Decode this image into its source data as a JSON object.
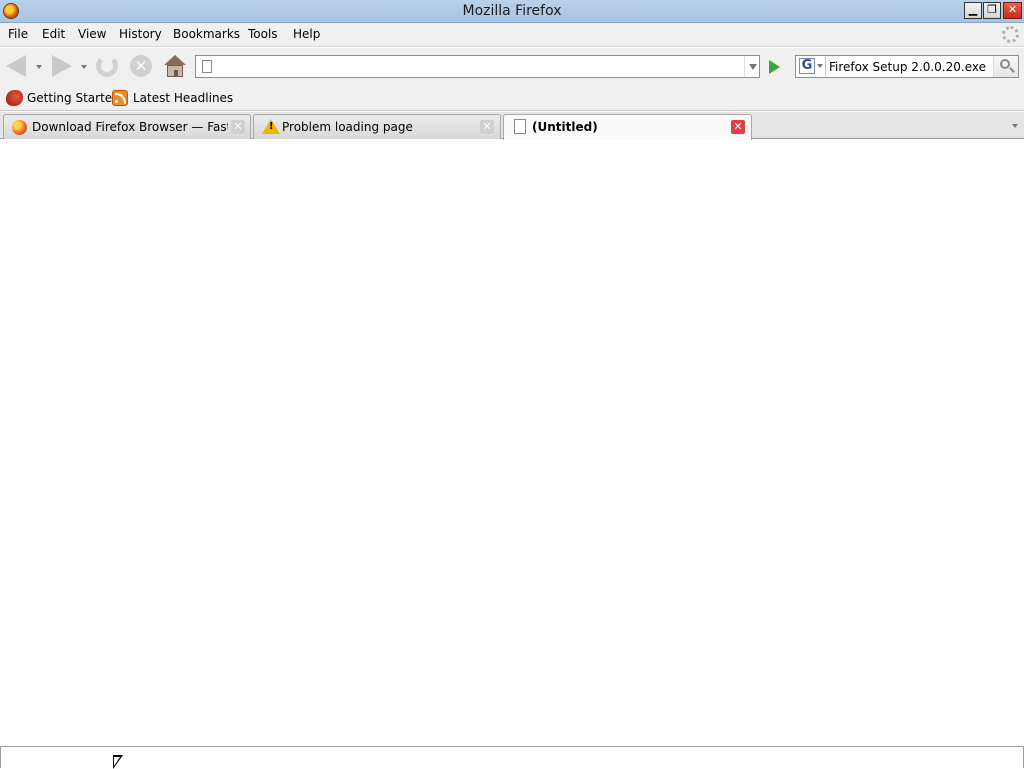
{
  "window": {
    "title": "Mozilla Firefox",
    "minimize_symbol": "▁",
    "maximize_symbol": "❐",
    "close_symbol": "✕"
  },
  "menu": {
    "items": [
      "File",
      "Edit",
      "View",
      "History",
      "Bookmarks",
      "Tools",
      "Help"
    ]
  },
  "navigation": {
    "url_value": "",
    "search_engine": "G",
    "search_value": "Firefox Setup 2.0.0.20.exe",
    "stop_symbol": "✕"
  },
  "bookmarks": {
    "items": [
      {
        "label": "Getting Started",
        "icon": "getting-started-icon"
      },
      {
        "label": "Latest Headlines",
        "icon": "rss-feed-icon"
      }
    ]
  },
  "tabs": [
    {
      "label": "Download Firefox Browser — Fast, ...",
      "icon": "firefox-icon",
      "active": false
    },
    {
      "label": "Problem loading page",
      "icon": "warning-icon",
      "active": false
    },
    {
      "label": "(Untitled)",
      "icon": "document-icon",
      "active": true
    }
  ],
  "tab_close_symbol": "✕",
  "status": {
    "text": ""
  },
  "colors": {
    "titlebar": "#b9d1ea",
    "chrome": "#f0f0f0",
    "go_green": "#3da33d",
    "close_red": "#e04040"
  }
}
